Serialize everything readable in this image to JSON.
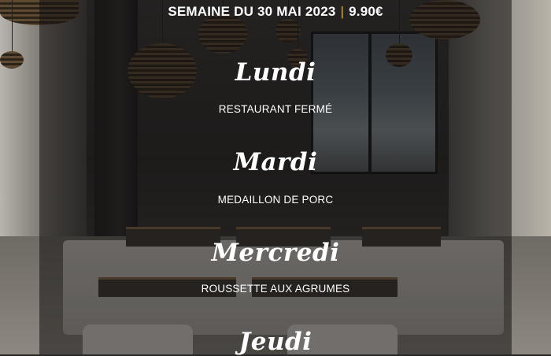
{
  "header": {
    "week_label": "SEMAINE DU 30 MAI 2023",
    "separator": "|",
    "price": "9.90€"
  },
  "menu": [
    {
      "day": "Lundi",
      "dish": "RESTAURANT FERMÉ"
    },
    {
      "day": "Mardi",
      "dish": "MEDAILLON DE PORC"
    },
    {
      "day": "Mercredi",
      "dish": "ROUSSETTE AUX AGRUMES"
    },
    {
      "day": "Jeudi",
      "dish": ""
    }
  ],
  "colors": {
    "separator": "#e0b12b",
    "text": "#ffffff",
    "panel_overlay": "rgba(18,17,16,0.55)"
  },
  "background": {
    "description_icon": "restaurant-interior-photo"
  }
}
